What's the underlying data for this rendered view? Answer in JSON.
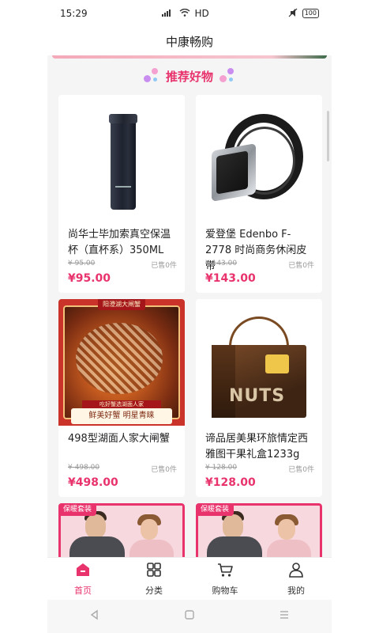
{
  "status": {
    "time": "15:29",
    "network": "HD",
    "battery": "100"
  },
  "header": {
    "title": "中康畅购"
  },
  "section": {
    "title": "推荐好物"
  },
  "products": [
    {
      "name": "尚华士毕加索真空保温杯（直杯系）350ML",
      "original_price": "¥ 95.00",
      "sold": "已售0件",
      "price": "¥95.00"
    },
    {
      "name": "爱登堡 Edenbo F-2778 时尚商务休闲皮带",
      "original_price": "¥ 143.00",
      "sold": "已售0件",
      "price": "¥143.00"
    },
    {
      "name": "498型湖面人家大闸蟹",
      "original_price": "¥ 498.00",
      "sold": "已售0件",
      "price": "¥498.00"
    },
    {
      "name": "谛品居美果环旅情定西雅图干果礼盒1233g",
      "original_price": "¥ 128.00",
      "sold": "已售0件",
      "price": "¥128.00"
    }
  ],
  "image_texts": {
    "crab_top": "阳澄湖大闸蟹",
    "crab_sub": "吃好蟹选湖面人家",
    "crab_slogan": "鲜美好蟹  明星青睐",
    "nuts": "NUTS",
    "thermal_tag": "保暖套装"
  },
  "tabs": [
    {
      "label": "首页",
      "icon": "home-icon"
    },
    {
      "label": "分类",
      "icon": "grid-icon"
    },
    {
      "label": "购物车",
      "icon": "cart-icon"
    },
    {
      "label": "我的",
      "icon": "user-icon"
    }
  ],
  "colors": {
    "accent": "#e8336d",
    "background": "#f5f5f5"
  }
}
